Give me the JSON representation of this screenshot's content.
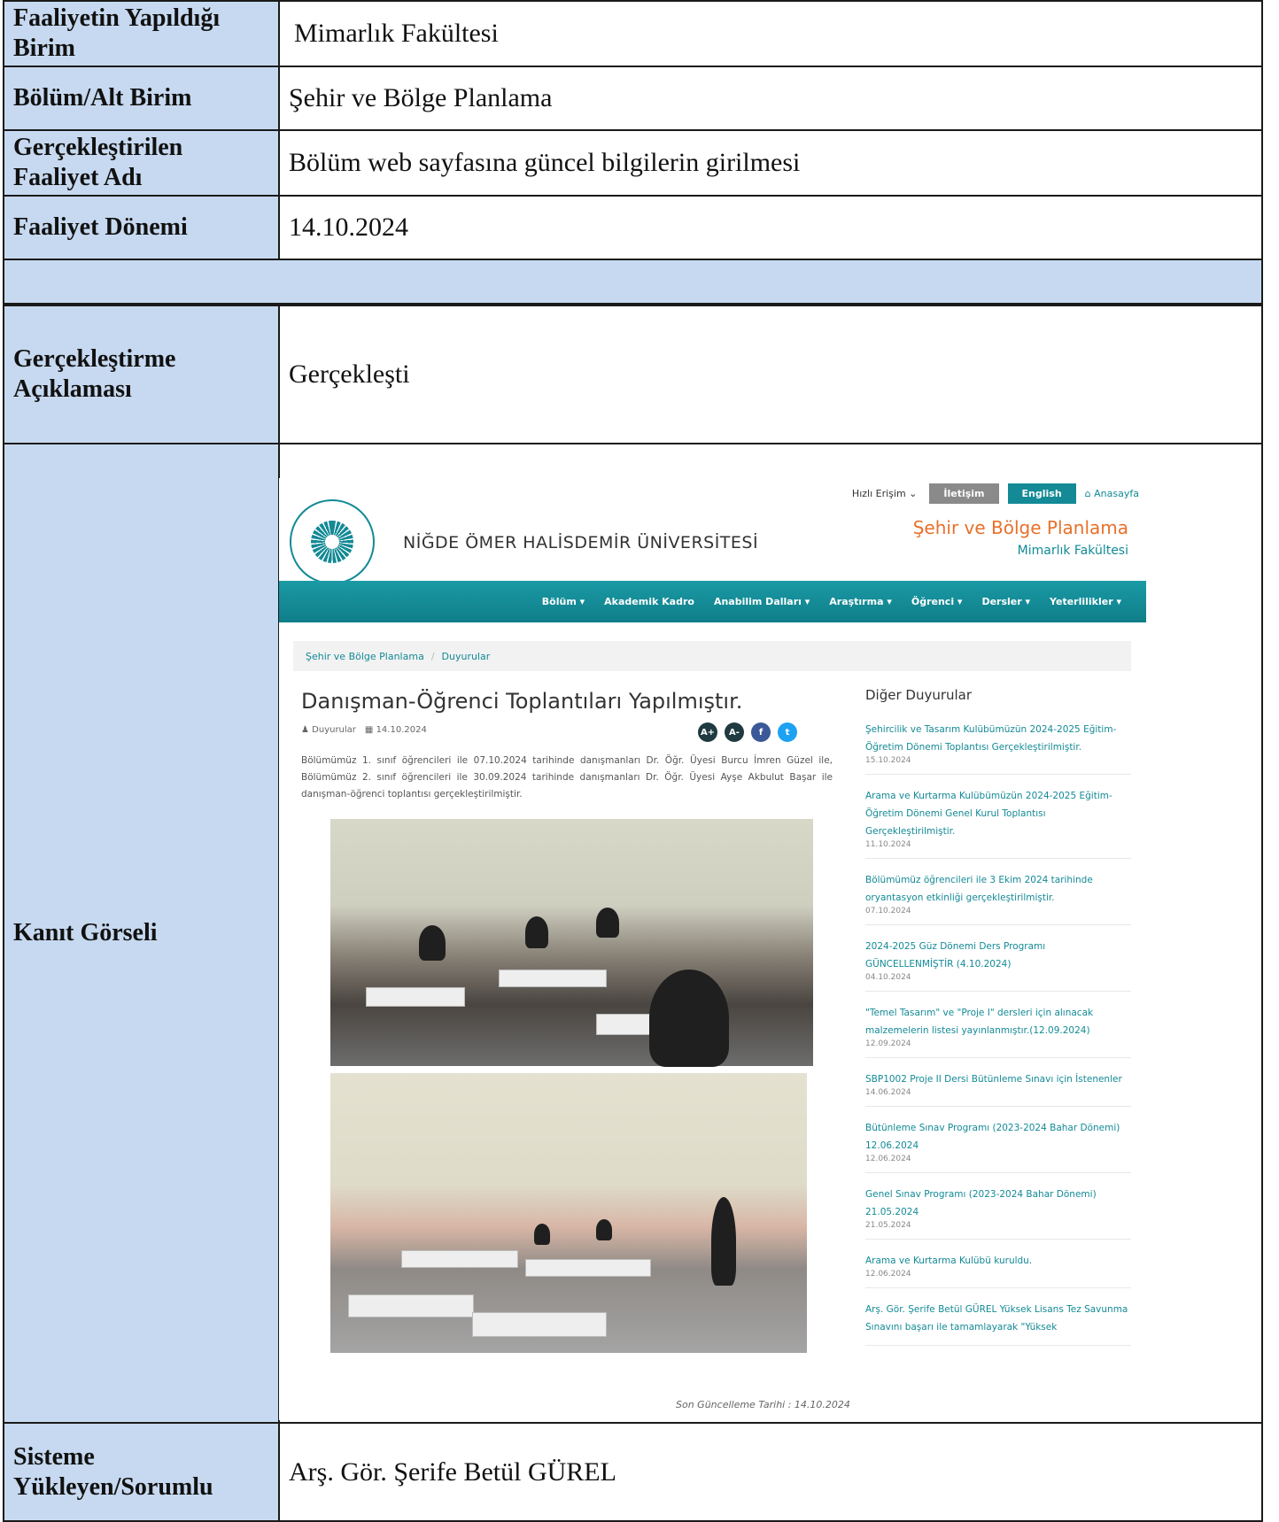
{
  "rows": {
    "birim": {
      "label": "Faaliyetin Yapıldığı Birim",
      "value": "Mimarlık Fakültesi"
    },
    "bolum": {
      "label": "Bölüm/Alt Birim",
      "value": "Şehir ve Bölge Planlama"
    },
    "faaliyet": {
      "label": "Gerçekleştirilen Faaliyet Adı",
      "value": "Bölüm web sayfasına güncel bilgilerin girilmesi"
    },
    "donem": {
      "label": "Faaliyet Dönemi",
      "value": "14.10.2024"
    },
    "aciklama": {
      "label": "Gerçekleştirme Açıklaması",
      "value": "Gerçekleşti"
    },
    "kanit": {
      "label": "Kanıt Görseli"
    },
    "sorumlu": {
      "label": "Sisteme Yükleyen/Sorumlu",
      "value": "Arş. Gör. Şerife Betül GÜREL"
    }
  },
  "website": {
    "topbar": {
      "quick_access": "Hızlı Erişim",
      "contact": "İletişim",
      "english": "English",
      "home": "Anasayfa"
    },
    "university": "NİĞDE ÖMER HALİSDEMİR ÜNİVERSİTESİ",
    "department": "Şehir ve Bölge Planlama",
    "faculty": "Mimarlık Fakültesi",
    "nav": [
      "Bölüm ▾",
      "Akademik Kadro",
      "Anabilim Dalları ▾",
      "Araştırma ▾",
      "Öğrenci ▾",
      "Dersler ▾",
      "Yeterlilikler ▾"
    ],
    "breadcrumb": [
      "Şehir ve Bölge Planlama",
      "Duyurular"
    ],
    "article": {
      "title": "Danışman-Öğrenci Toplantıları Yapılmıştır.",
      "category": "Duyurular",
      "date": "14.10.2024",
      "body": "Bölümümüz 1. sınıf öğrencileri ile 07.10.2024 tarihinde danışmanları Dr. Öğr. Üyesi Burcu İmren Güzel ile, Bölümümüz 2. sınıf öğrencileri ile 30.09.2024 tarihinde danışmanları Dr. Öğr. Üyesi Ayşe Akbulut Başar ile danışman-öğrenci toplantısı gerçekleştirilmiştir."
    },
    "social": [
      "A+",
      "A-",
      "f",
      "t"
    ],
    "updated": "Son Güncelleme Tarihi : 14.10.2024",
    "sidebar_title": "Diğer Duyurular",
    "announcements": [
      {
        "title": "Şehircilik ve Tasarım Kulübümüzün 2024-2025 Eğitim-Öğretim Dönemi Toplantısı Gerçekleştirilmiştir.",
        "date": "15.10.2024"
      },
      {
        "title": "Arama ve Kurtarma Kulübümüzün 2024-2025 Eğitim-Öğretim Dönemi Genel Kurul Toplantısı Gerçekleştirilmiştir.",
        "date": "11.10.2024"
      },
      {
        "title": "Bölümümüz öğrencileri ile 3 Ekim 2024 tarihinde oryantasyon etkinliği gerçekleştirilmiştir.",
        "date": "07.10.2024"
      },
      {
        "title": "2024-2025 Güz Dönemi Ders Programı GÜNCELLENMİŞTİR (4.10.2024)",
        "date": "04.10.2024"
      },
      {
        "title": "\"Temel Tasarım\" ve \"Proje I\" dersleri için alınacak malzemelerin listesi yayınlanmıştır.(12.09.2024)",
        "date": "12.09.2024"
      },
      {
        "title": "SBP1002 Proje II Dersi Bütünleme Sınavı için İstenenler",
        "date": "14.06.2024"
      },
      {
        "title": "Bütünleme Sınav Programı (2023-2024 Bahar Dönemi) 12.06.2024",
        "date": "12.06.2024"
      },
      {
        "title": "Genel Sınav Programı (2023-2024 Bahar Dönemi) 21.05.2024",
        "date": "21.05.2024"
      },
      {
        "title": "Arama ve Kurtarma Kulübü kuruldu.",
        "date": "12.06.2024"
      },
      {
        "title": "Arş. Gör. Şerife Betül GÜREL Yüksek Lisans Tez Savunma Sınavını başarı ile tamamlayarak \"Yüksek",
        "date": ""
      }
    ]
  }
}
